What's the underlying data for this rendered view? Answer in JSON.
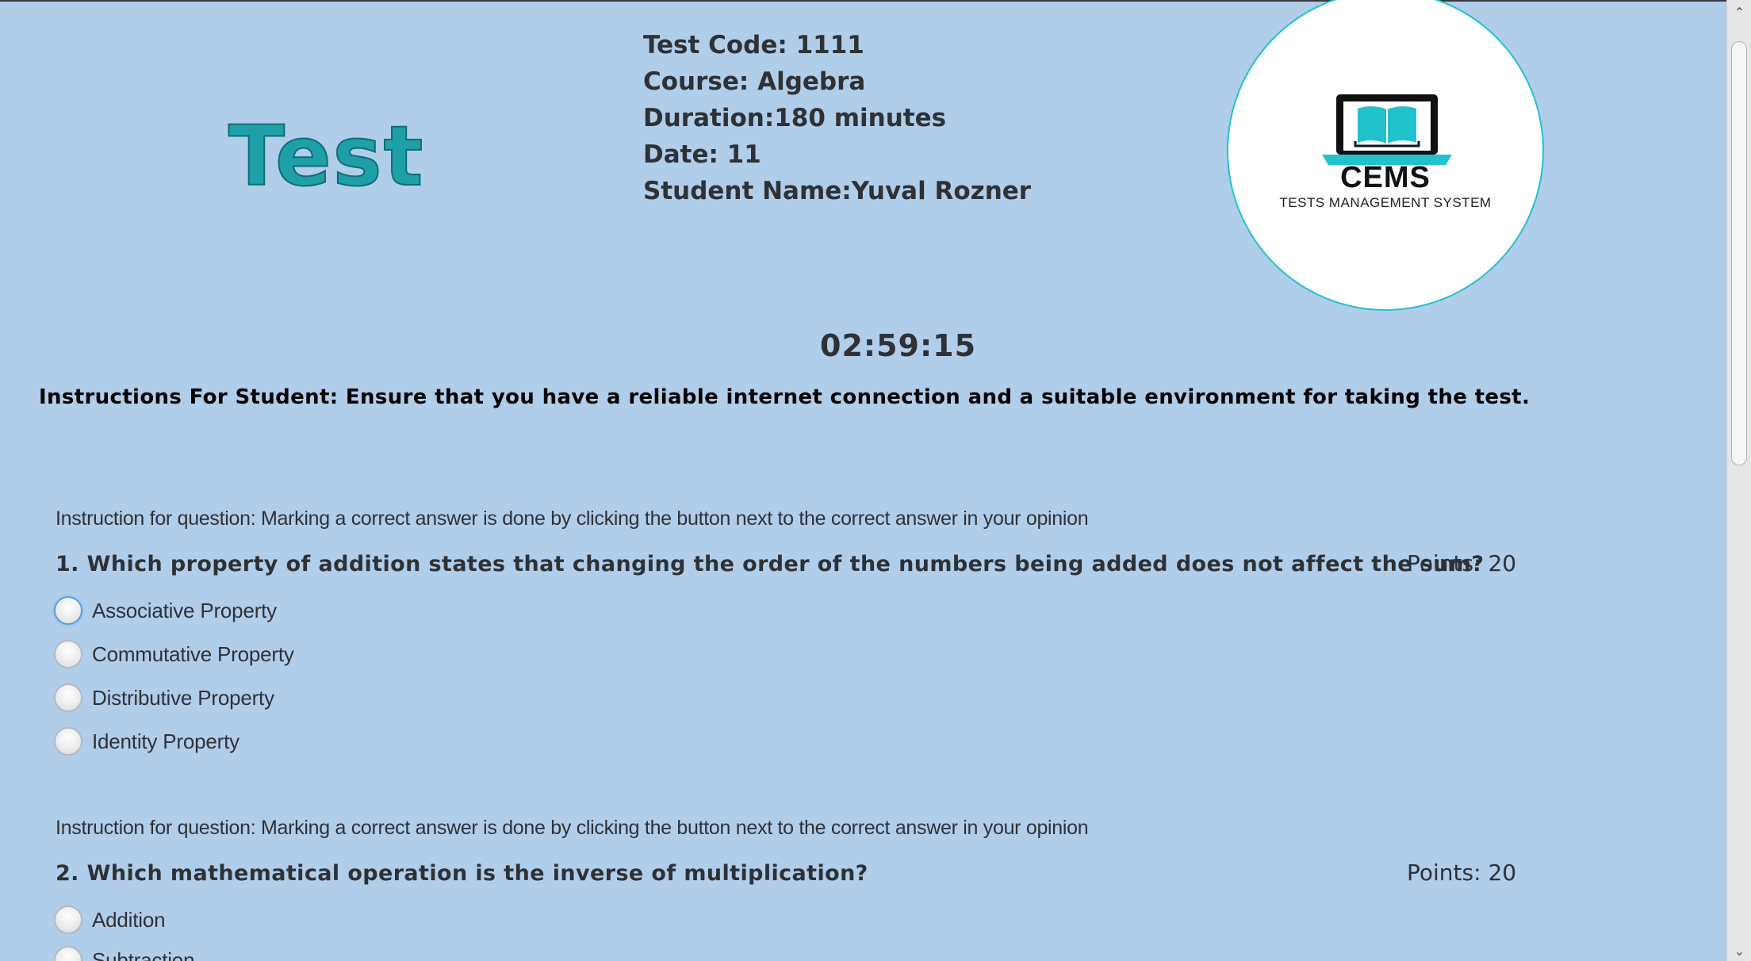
{
  "header": {
    "title": "Test",
    "test_code": "Test Code: 1111",
    "course": "Course: Algebra",
    "duration": "Duration:180 minutes",
    "date": "Date: 11",
    "student_name": "Student Name:Yuval Rozner"
  },
  "logo": {
    "name": "CEMS",
    "subtitle": "TESTS MANAGEMENT SYSTEM",
    "icon": "laptop-book-icon",
    "accent_color": "#22c2cc"
  },
  "timer": "02:59:15",
  "student_instructions": "Instructions For Student: Ensure that you have a reliable internet connection and a suitable environment for taking the test.",
  "questions": [
    {
      "instruction": "Instruction for question: Marking a correct answer is done by clicking the button next to the correct answer in your opinion",
      "text": "1. Which property of addition states that changing the order of the numbers being added does not affect the sum?",
      "points": "Points: 20",
      "options": [
        "Associative Property",
        "Commutative Property",
        "Distributive Property",
        "Identity Property"
      ]
    },
    {
      "instruction": "Instruction for question: Marking a correct answer is done by clicking the button next to the correct answer in your opinion",
      "text": "2. Which mathematical operation is the inverse of multiplication?",
      "points": "Points: 20",
      "options": [
        "Addition",
        "Subtraction"
      ]
    }
  ],
  "colors": {
    "background": "#b0cdea",
    "title": "#1f9fa8",
    "text": "#2e3135"
  }
}
